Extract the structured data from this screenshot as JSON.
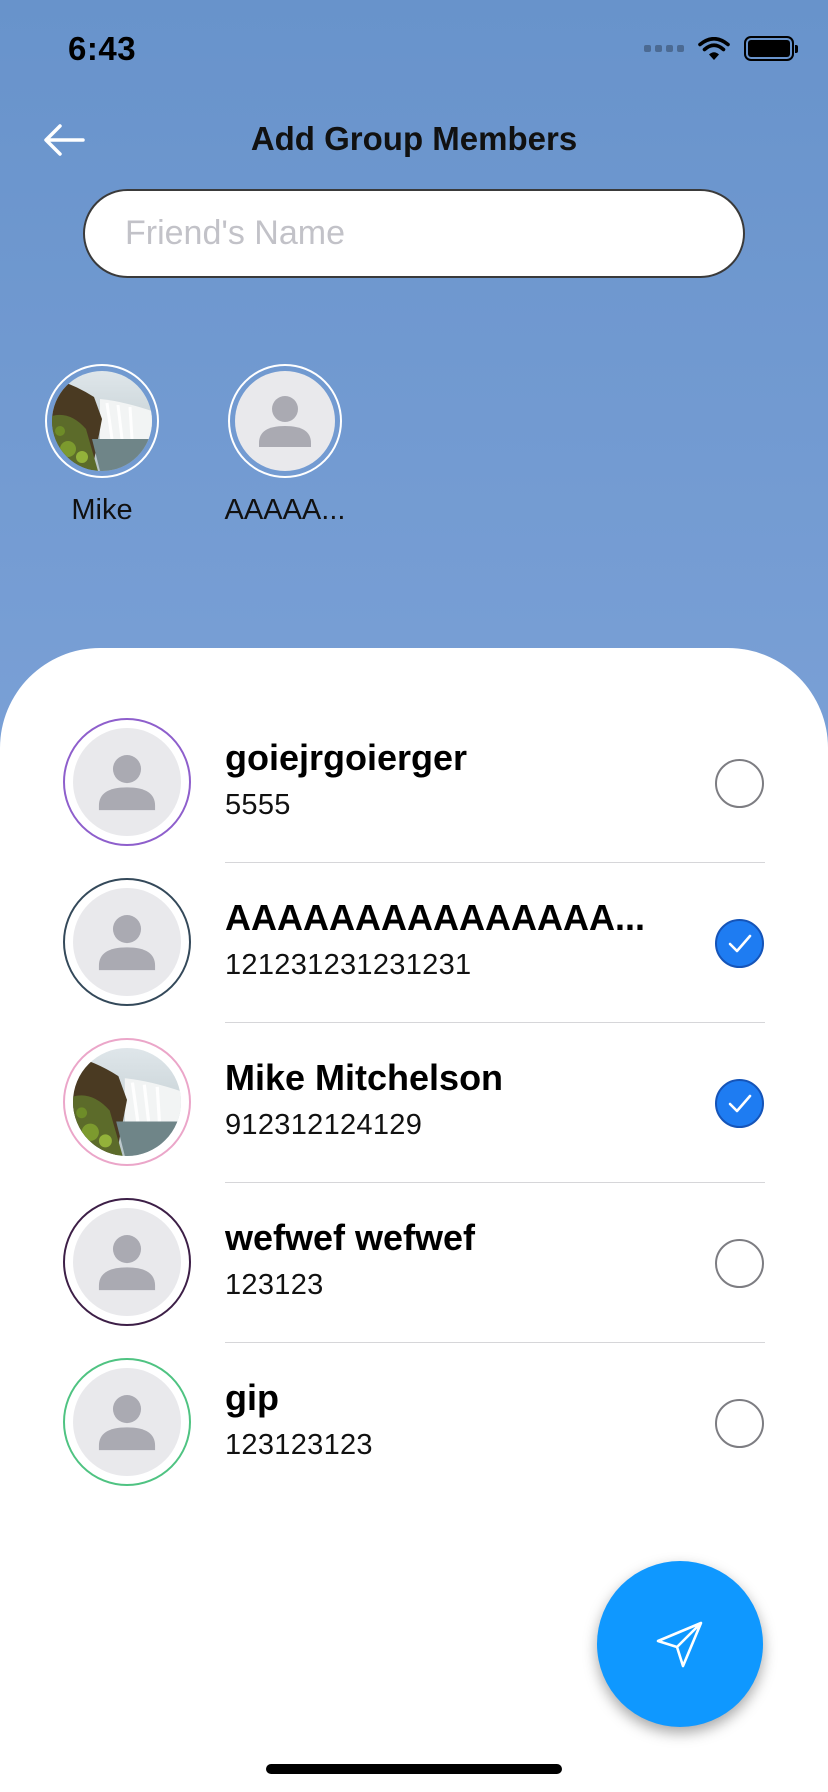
{
  "status_bar": {
    "time": "6:43"
  },
  "header": {
    "title": "Add Group Members"
  },
  "search": {
    "placeholder": "Friend's Name"
  },
  "selected": [
    {
      "name": "Mike",
      "photo": "landscape"
    },
    {
      "name": "AAAAA...",
      "photo": "placeholder"
    }
  ],
  "contacts": [
    {
      "name": "goiejrgoierger",
      "phone": "5555",
      "ring_color": "#8e5fcc",
      "photo": "placeholder",
      "selected": false
    },
    {
      "name": "AAAAAAAAAAAAAAA...",
      "phone": "121231231231231",
      "ring_color": "#34495a",
      "photo": "placeholder",
      "selected": true
    },
    {
      "name": "Mike Mitchelson",
      "phone": "912312124129",
      "ring_color": "#eba6c9",
      "photo": "landscape",
      "selected": true
    },
    {
      "name": "wefwef wefwef",
      "phone": "123123",
      "ring_color": "#3d1f47",
      "photo": "placeholder",
      "selected": false
    },
    {
      "name": "gip",
      "phone": "123123123",
      "ring_color": "#4fc382",
      "photo": "placeholder",
      "selected": false
    }
  ],
  "colors": {
    "header_bg": "#6b95cd",
    "check_selected": "#1e7cf2",
    "fab": "#0f98ff"
  },
  "icons": {
    "back": "arrow-left-icon",
    "send": "send-icon",
    "checkmark": "checkmark-icon"
  }
}
